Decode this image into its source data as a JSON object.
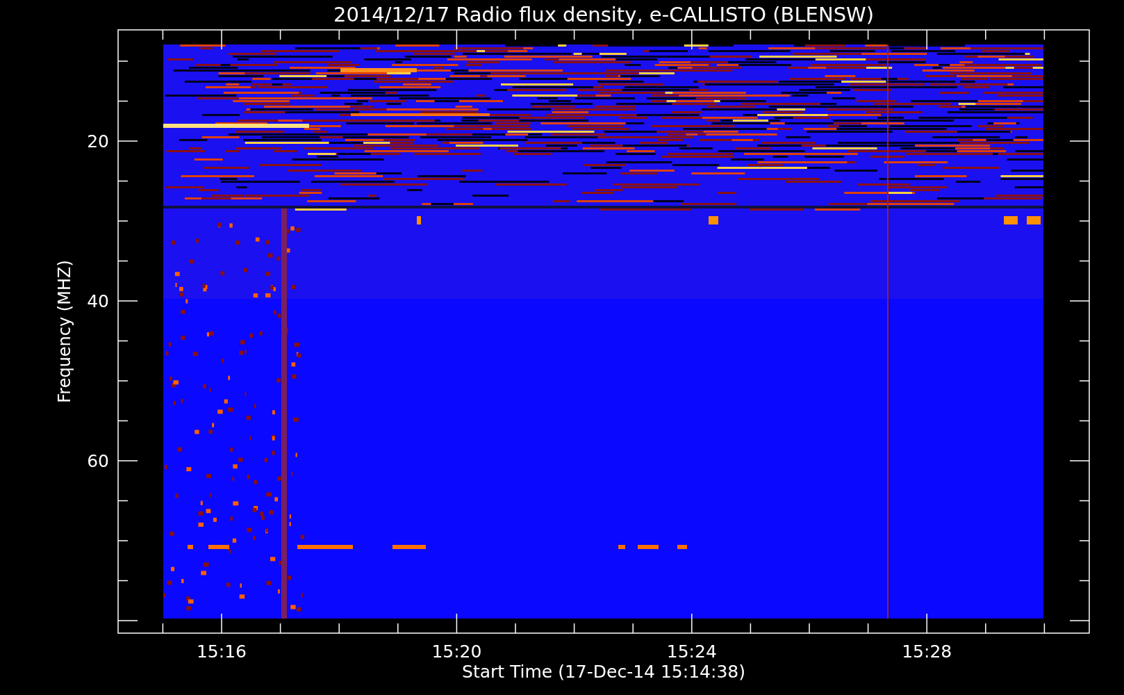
{
  "title": "2014/12/17  Radio flux density, e-CALLISTO (BLENSW)",
  "ylabel": "Frequency (MHZ)",
  "xlabel": "Start Time (17-Dec-14 15:14:38)",
  "yticks": [
    "20",
    "40",
    "60"
  ],
  "xticks": [
    "15:16",
    "15:20",
    "15:24",
    "15:28"
  ]
}
